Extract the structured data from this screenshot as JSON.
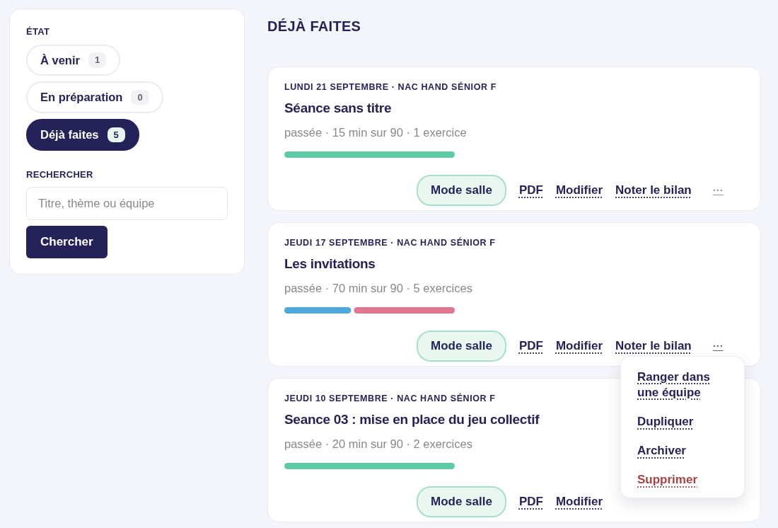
{
  "sidebar": {
    "state_label": "ÉTAT",
    "filters": [
      {
        "label": "À venir",
        "count": "1",
        "selected": false
      },
      {
        "label": "En préparation",
        "count": "0",
        "selected": false
      },
      {
        "label": "Déjà faites",
        "count": "5",
        "selected": true
      }
    ],
    "search_label": "RECHERCHER",
    "search": {
      "placeholder": "Titre, thème ou équipe"
    },
    "search_button": "Chercher"
  },
  "heading": "DÉJÀ FAITES",
  "sessions": [
    {
      "meta": "LUNDI 21 SEPTEMBRE · NAC HAND SÉNIOR F",
      "title": "Séance sans titre",
      "summary": "passée · 15 min sur 90 · 1 exercice",
      "segments": [
        {
          "level": 1,
          "color": "#5ecaa5"
        }
      ],
      "actions": [
        "Mode salle",
        "PDF",
        "Modifier",
        "Noter le bilan"
      ],
      "more": "···",
      "menu_open": false
    },
    {
      "meta": "JEUDI 17 SEPTEMBRE · NAC HAND SÉNIOR F",
      "title": "Les invitations",
      "summary": "passée · 70 min sur 90 · 5 exercices",
      "segments": [
        {
          "level": 0.4,
          "color": "#4fa8dc"
        },
        {
          "level": 0.6,
          "color": "#e07590"
        }
      ],
      "actions": [
        "Mode salle",
        "PDF",
        "Modifier",
        "Noter le bilan"
      ],
      "more": "···",
      "menu_open": true
    },
    {
      "meta": "JEUDI 10 SEPTEMBRE · NAC HAND SÉNIOR F",
      "title": "Seance 03 : mise en place du jeu collectif",
      "summary": "passée · 20 min sur 90 · 2 exercices",
      "segments": [
        {
          "level": 1,
          "color": "#5ecaa5"
        }
      ],
      "actions": [
        "Mode salle",
        "PDF",
        "Modifier"
      ],
      "menu_open": false
    }
  ],
  "menu": [
    {
      "label": "Ranger dans une équipe",
      "kind": "normal"
    },
    {
      "label": "Dupliquer",
      "kind": "normal"
    },
    {
      "label": "Archiver",
      "kind": "normal"
    },
    {
      "label": "Supprimer",
      "kind": "danger"
    }
  ]
}
